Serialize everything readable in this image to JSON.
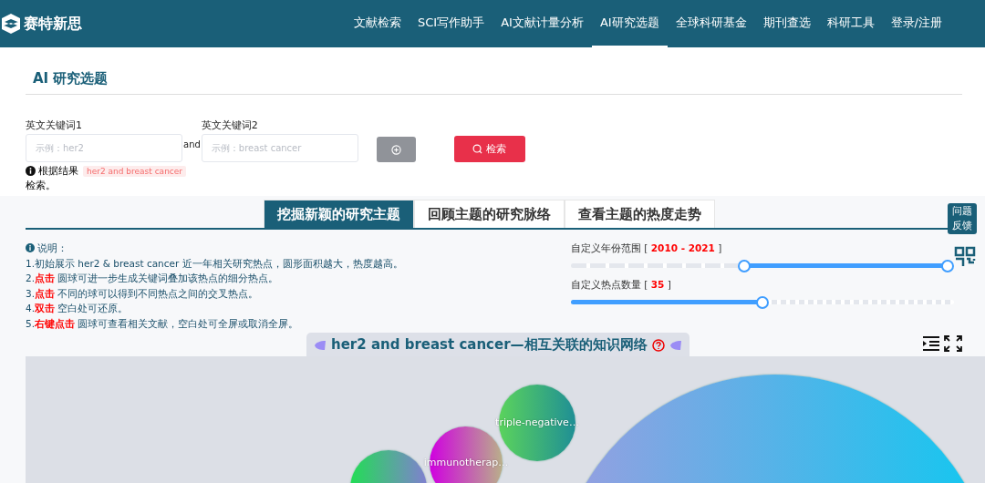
{
  "header": {
    "logo": "赛特新思",
    "nav": [
      {
        "label": "文献检索",
        "selected": false
      },
      {
        "label": "SCI写作助手",
        "selected": false
      },
      {
        "label": "AI文献计量分析",
        "selected": false
      },
      {
        "label": "AI研究选题",
        "selected": true
      },
      {
        "label": "全球科研基金",
        "selected": false
      },
      {
        "label": "期刊查选",
        "selected": false
      },
      {
        "label": "科研工具",
        "selected": false
      },
      {
        "label": "登录/注册",
        "selected": false
      }
    ]
  },
  "page_title": "AI 研究选题",
  "form": {
    "keyword1": {
      "label": "英文关键词1",
      "placeholder": "示例：her2"
    },
    "joiner": "and",
    "keyword2": {
      "label": "英文关键词2",
      "placeholder": "示例：breast cancer"
    },
    "search_button": "检索",
    "result_label": "根据结果",
    "result_tag": "her2 and breast cancer",
    "result_suffix": "检索。"
  },
  "tabs": [
    {
      "label": "挖掘新颖的研究主题",
      "selected": true
    },
    {
      "label": "回顾主题的研究脉络",
      "selected": false
    },
    {
      "label": "查看主题的热度走势",
      "selected": false
    }
  ],
  "feedback": "问题反馈",
  "instructions": {
    "heading": "说明：",
    "lines": [
      "1.初始展示 her2 & breast cancer 近一年相关研究热点，圆形面积越大，热度越高。",
      "2.**点击** 圆球可进一步生成关键词叠加该热点的细分热点。",
      "3.**点击** 不同的球可以得到不同热点之间的交叉热点。",
      "4.**双击** 空白处可还原。",
      "5.**右键点击** 圆球可查看相关文献，空白处可全屏或取消全屏。"
    ]
  },
  "year_range": {
    "label": "自定义年份范围 [ **2010 - 2021** ]",
    "thumbs": [
      {
        "level": 0.45
      },
      {
        "level": 1.0
      }
    ]
  },
  "hotspot_count": {
    "label": "自定义热点数量 [ **35** ]",
    "level": 0.5
  },
  "network": {
    "title": "her2 and breast cancer—相互关联的知识网络",
    "bubbles": [
      {
        "kind": "topic",
        "label": "triple-negative…"
      },
      {
        "kind": "topic",
        "label": "immunotherap…"
      },
      {
        "kind": "topic"
      },
      {
        "kind": "topic"
      }
    ]
  }
}
